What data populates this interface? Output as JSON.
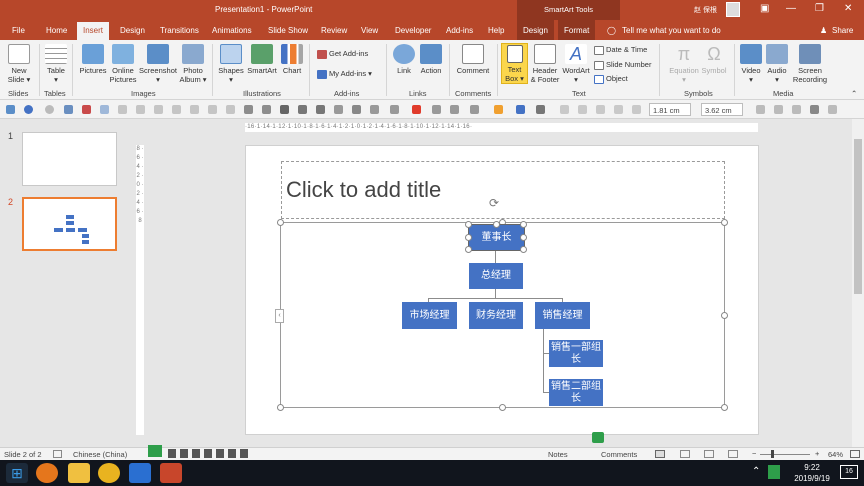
{
  "app": {
    "title": "Presentation1  -  PowerPoint",
    "context_group": "SmartArt Tools",
    "user_name": "赵 保根",
    "win_minimize": "—",
    "win_restore": "❐",
    "win_close": "✕",
    "ribbon_display": "▣"
  },
  "tabs": [
    "File",
    "Home",
    "Insert",
    "Design",
    "Transitions",
    "Animations",
    "Slide Show",
    "Review",
    "View",
    "Developer",
    "Add-ins",
    "Help",
    "Design",
    "Format"
  ],
  "tell_me": "Tell me what you want to do",
  "share": "Share",
  "ribbon": {
    "slides": {
      "new_slide": "New\nSlide ▾",
      "group": "Slides"
    },
    "tables": {
      "table": "Table\n▾",
      "group": "Tables"
    },
    "images": {
      "pictures": "Pictures",
      "online_pictures": "Online\nPictures",
      "screenshot": "Screenshot\n▾",
      "photo_album": "Photo\nAlbum ▾",
      "group": "Images"
    },
    "illustrations": {
      "shapes": "Shapes\n▾",
      "smartart": "SmartArt",
      "chart": "Chart",
      "group": "Illustrations"
    },
    "addins": {
      "get_addins": "Get Add-ins",
      "my_addins": "My Add-ins ▾",
      "group": "Add-ins"
    },
    "links": {
      "link": "Link",
      "action": "Action",
      "group": "Links"
    },
    "comments": {
      "comment": "Comment",
      "group": "Comments"
    },
    "text": {
      "text_box": "Text\nBox ▾",
      "header_footer": "Header\n& Footer",
      "wordart": "WordArt\n▾",
      "date_time": "Date & Time",
      "slide_number": "Slide Number",
      "object": "Object",
      "group": "Text"
    },
    "symbols": {
      "equation": "Equation\n▾",
      "symbol": "Symbol",
      "group": "Symbols"
    },
    "media": {
      "video": "Video\n▾",
      "audio": "Audio\n▾",
      "screen_recording": "Screen\nRecording",
      "group": "Media"
    }
  },
  "qat": {
    "height": "1.81 cm",
    "width": "3.62 cm"
  },
  "ruler_text": "·16·1·14·1·12·1·10·1·8·1·6·1·4·1·2·1·0·1·2·1·4·1·6·1·8·1·10·1·12·1·14·1·16·",
  "ruler_v_text": "8 · 6 · 4 · 2 · 0 · 2 · 4 · 6 · 8",
  "thumbnails": [
    {
      "num": "1"
    },
    {
      "num": "2"
    }
  ],
  "slide": {
    "title_placeholder": "Click to add title",
    "org": {
      "chairman": "董事长",
      "gm": "总经理",
      "marketing": "市场经理",
      "finance": "财务经理",
      "sales": "销售经理",
      "sales_dept1": "销售一部组长",
      "sales_dept2": "销售二部组长"
    }
  },
  "status": {
    "slide_info": "Slide 2 of 2",
    "language": "Chinese (China)",
    "notes": "Notes",
    "comments": "Comments",
    "zoom": "64%"
  },
  "taskbar": {
    "time": "9:22",
    "date": "2019/9/19",
    "notif": "16"
  },
  "colors": {
    "accent": "#b7472a",
    "smartart_fill": "#4472c4",
    "selection": "#ed7d31"
  }
}
